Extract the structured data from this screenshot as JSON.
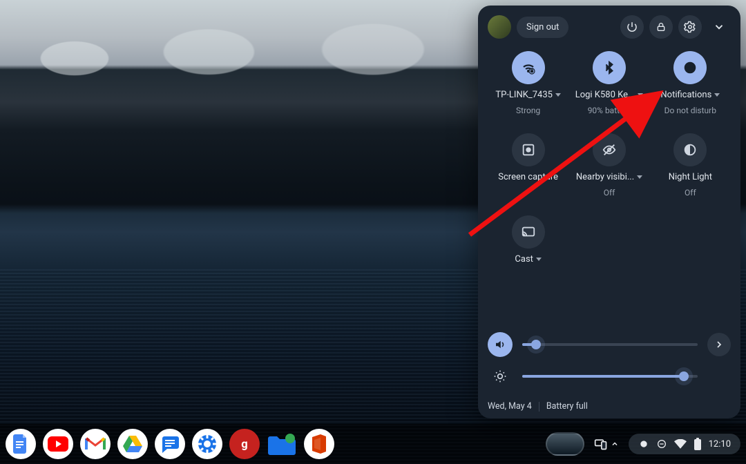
{
  "header": {
    "sign_out": "Sign out"
  },
  "tiles": {
    "wifi": {
      "label": "TP-LINK_7435",
      "sub": "Strong"
    },
    "bt": {
      "label": "Logi K580 Ke...",
      "sub": "90% battery"
    },
    "notif": {
      "label": "Notifications",
      "sub": "Do not disturb"
    },
    "screen": {
      "label": "Screen capture",
      "sub": ""
    },
    "nearby": {
      "label": "Nearby visibi...",
      "sub": "Off"
    },
    "night": {
      "label": "Night Light",
      "sub": "Off"
    },
    "cast": {
      "label": "Cast",
      "sub": ""
    }
  },
  "sliders": {
    "volume_pct": 8,
    "brightness_pct": 92
  },
  "footer": {
    "date": "Wed, May 4",
    "battery": "Battery full"
  },
  "shelf": {
    "time": "12:10"
  }
}
